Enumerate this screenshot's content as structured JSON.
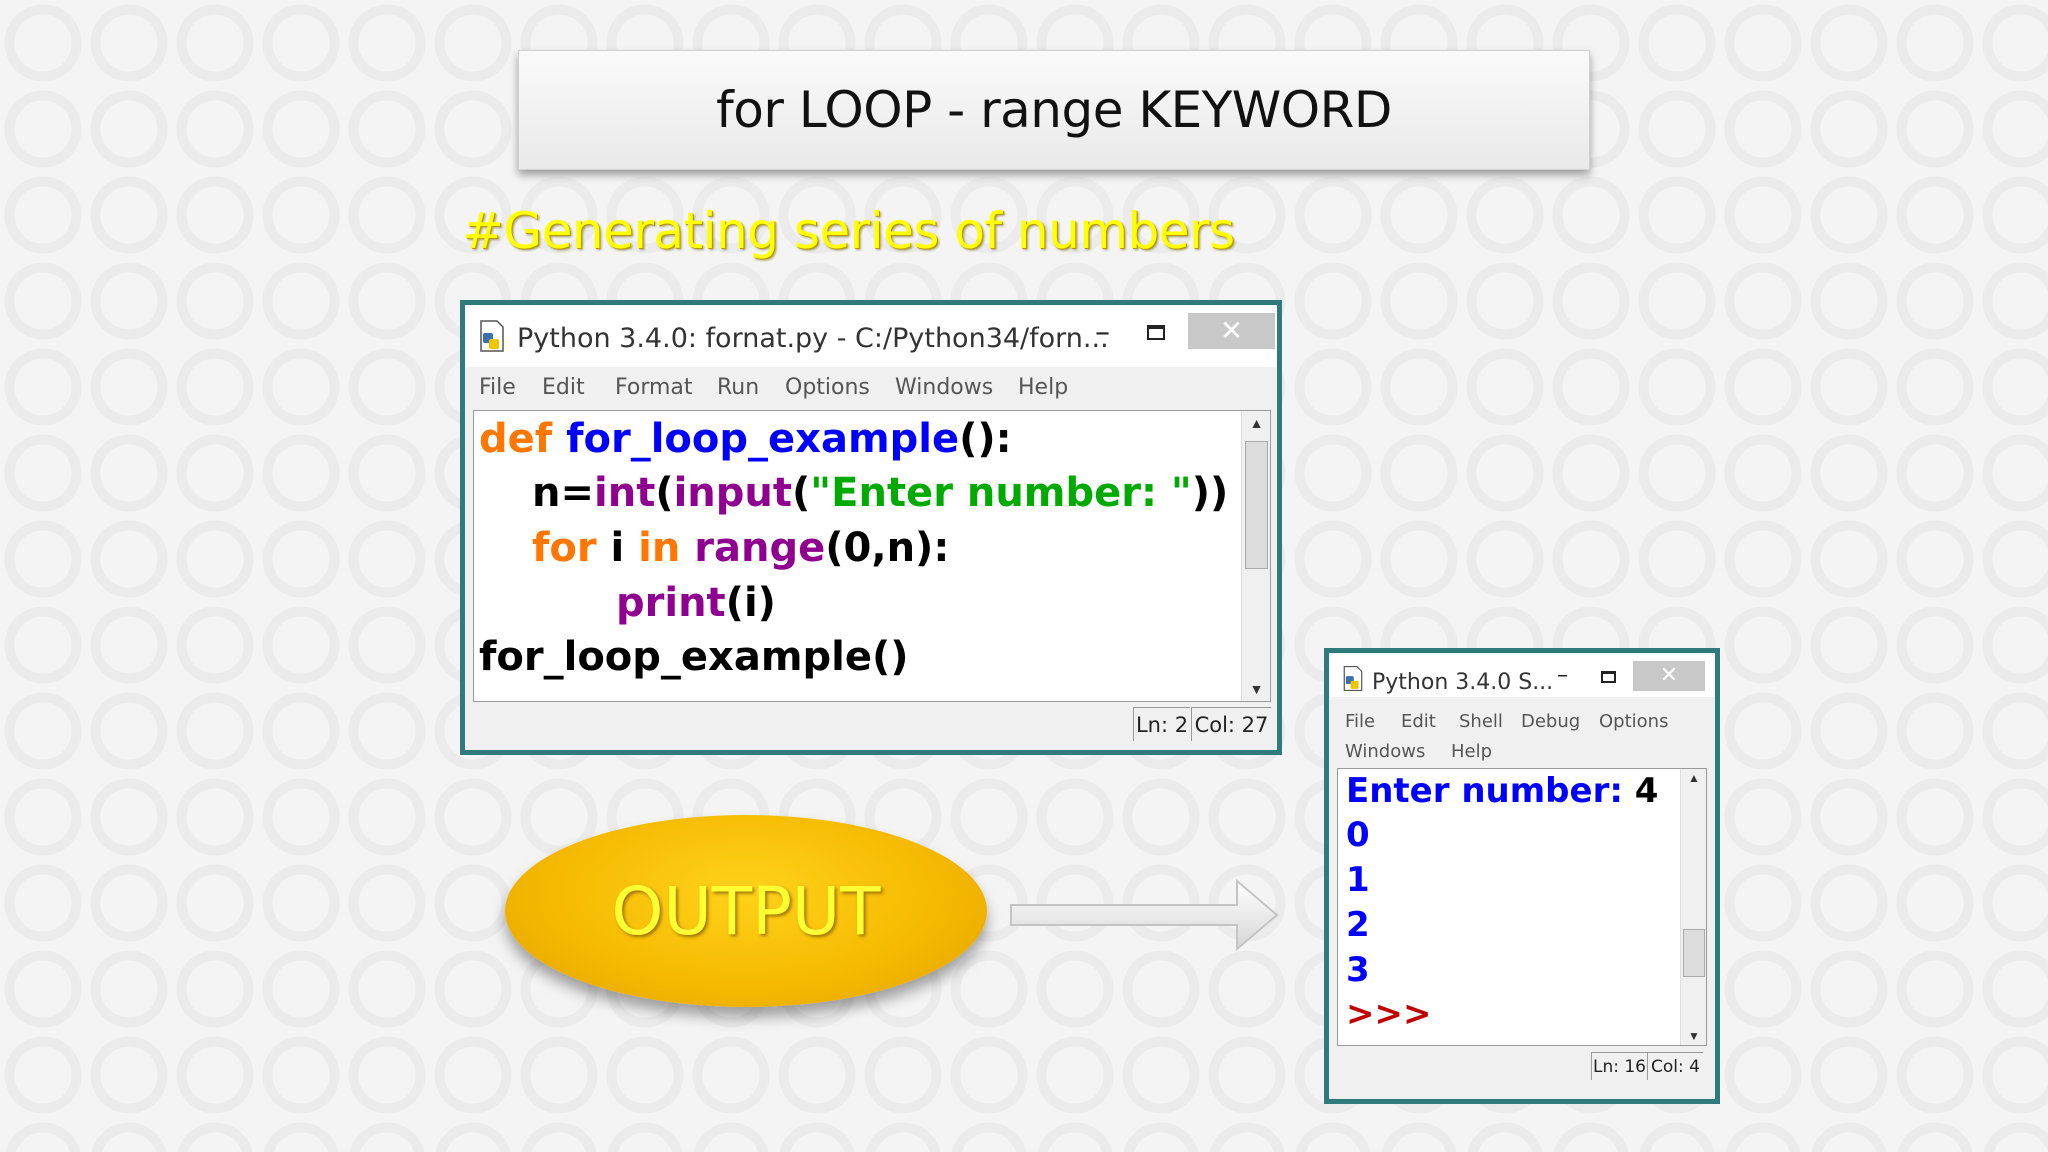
{
  "slide": {
    "title": "for LOOP - range KEYWORD",
    "subtitle": "#Generating series of numbers",
    "output_label": "OUTPUT"
  },
  "editor": {
    "window_title": "Python 3.4.0: fornat.py - C:/Python34/forn...",
    "menu": [
      "File",
      "Edit",
      "Format",
      "Run",
      "Options",
      "Windows",
      "Help"
    ],
    "code": {
      "line1": {
        "kw": "def",
        "name": "for_loop_example",
        "rest": "():"
      },
      "line2": {
        "a": "n=",
        "b": "int",
        "c": "(",
        "d": "input",
        "e": "(",
        "f": "\"Enter number: \"",
        "g": "))"
      },
      "line3": {
        "a": "for",
        "b": " i ",
        "c": "in",
        "d": " ",
        "e": "range",
        "f": "(0,n):"
      },
      "line4": {
        "a": "print",
        "b": "(i)"
      },
      "line5": "for_loop_example()"
    },
    "status_ln": "Ln: 2",
    "status_col": "Col: 27"
  },
  "shell": {
    "window_title": "Python 3.4.0 S...",
    "menu_row1": [
      "File",
      "Edit",
      "Shell",
      "Debug",
      "Options"
    ],
    "menu_row2": [
      "Windows",
      "Help"
    ],
    "prompt_label": "Enter number: ",
    "input_value": "4",
    "outputs": [
      "0",
      "1",
      "2",
      "3"
    ],
    "prompt": ">>>",
    "status_ln": "Ln: 16",
    "status_col": "Col: 4"
  },
  "colors": {
    "keyword": "#ff7700",
    "function_name": "#0000ff",
    "builtin": "#900090",
    "string": "#00aa00",
    "shell_output": "#0000ff",
    "shell_prompt": "#c00000",
    "window_border": "#2f7a7a"
  },
  "icons": [
    "python-file-icon",
    "minimize-icon",
    "maximize-icon",
    "close-icon",
    "scroll-up-icon",
    "scroll-down-icon",
    "right-arrow-icon"
  ]
}
